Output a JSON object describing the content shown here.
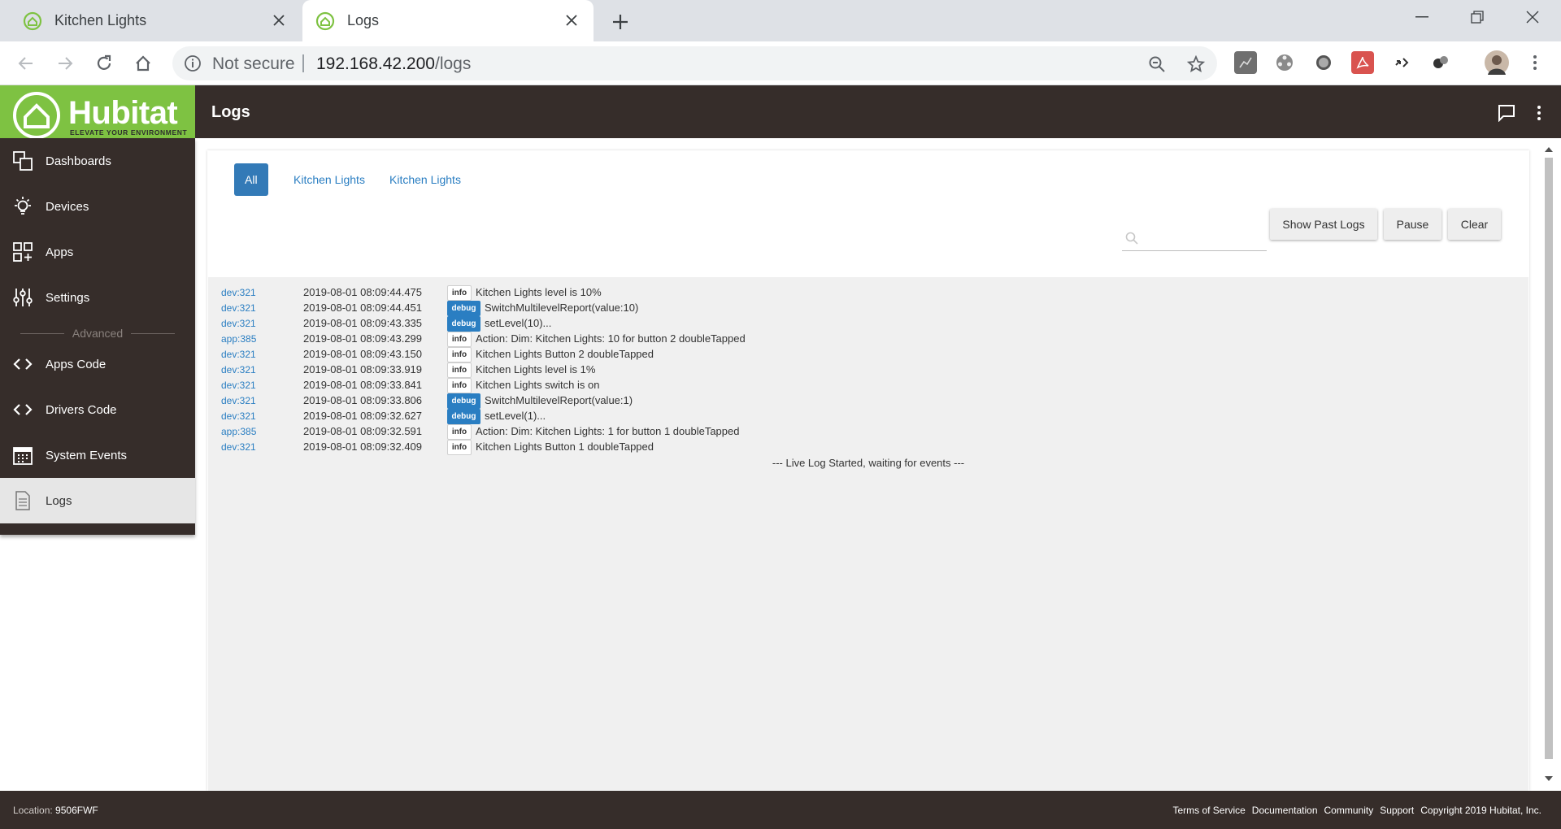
{
  "browser": {
    "tabs": [
      {
        "title": "Kitchen Lights",
        "active": false
      },
      {
        "title": "Logs",
        "active": true
      }
    ],
    "not_secure": "Not secure",
    "url_host": "192.168.42.200",
    "url_path": "/logs",
    "colors": {
      "tabstrip": "#dee1e6",
      "omnibox": "#f1f3f4"
    }
  },
  "app": {
    "logo_text": "Hubitat",
    "logo_tagline": "ELEVATE YOUR ENVIRONMENT",
    "page_title": "Logs",
    "colors": {
      "header": "#362d2a",
      "logo_green": "#7ec242",
      "link_blue": "#2a7ec2",
      "debug_blue": "#2a7ec2"
    }
  },
  "sidebar": {
    "items": [
      {
        "label": "Dashboards",
        "icon": "dashboards-icon"
      },
      {
        "label": "Devices",
        "icon": "lightbulb-icon"
      },
      {
        "label": "Apps",
        "icon": "apps-grid-icon"
      },
      {
        "label": "Settings",
        "icon": "sliders-icon"
      },
      {
        "label": "Apps Code",
        "icon": "code-icon"
      },
      {
        "label": "Drivers Code",
        "icon": "code-icon"
      },
      {
        "label": "System Events",
        "icon": "calendar-icon"
      },
      {
        "label": "Logs",
        "icon": "document-icon",
        "active": true
      }
    ],
    "advanced_label": "Advanced"
  },
  "filters": [
    "All",
    "Kitchen Lights",
    "Kitchen Lights"
  ],
  "search": {
    "placeholder": ""
  },
  "buttons": {
    "show_past": "Show Past Logs",
    "pause": "Pause",
    "clear": "Clear"
  },
  "logs": [
    {
      "src": "dev:321",
      "ts": "2019-08-01 08:09:44.475",
      "level": "info",
      "msg": "Kitchen Lights level is 10%"
    },
    {
      "src": "dev:321",
      "ts": "2019-08-01 08:09:44.451",
      "level": "debug",
      "msg": "SwitchMultilevelReport(value:10)"
    },
    {
      "src": "dev:321",
      "ts": "2019-08-01 08:09:43.335",
      "level": "debug",
      "msg": "setLevel(10)..."
    },
    {
      "src": "app:385",
      "ts": "2019-08-01 08:09:43.299",
      "level": "info",
      "msg": "Action: Dim: Kitchen Lights: 10 for button 2 doubleTapped"
    },
    {
      "src": "dev:321",
      "ts": "2019-08-01 08:09:43.150",
      "level": "info",
      "msg": "Kitchen Lights Button 2 doubleTapped"
    },
    {
      "src": "dev:321",
      "ts": "2019-08-01 08:09:33.919",
      "level": "info",
      "msg": "Kitchen Lights level is 1%"
    },
    {
      "src": "dev:321",
      "ts": "2019-08-01 08:09:33.841",
      "level": "info",
      "msg": "Kitchen Lights switch is on"
    },
    {
      "src": "dev:321",
      "ts": "2019-08-01 08:09:33.806",
      "level": "debug",
      "msg": "SwitchMultilevelReport(value:1)"
    },
    {
      "src": "dev:321",
      "ts": "2019-08-01 08:09:32.627",
      "level": "debug",
      "msg": "setLevel(1)..."
    },
    {
      "src": "app:385",
      "ts": "2019-08-01 08:09:32.591",
      "level": "info",
      "msg": "Action: Dim: Kitchen Lights: 1 for button 1 doubleTapped"
    },
    {
      "src": "dev:321",
      "ts": "2019-08-01 08:09:32.409",
      "level": "info",
      "msg": "Kitchen Lights Button 1 doubleTapped"
    }
  ],
  "live_message": "--- Live Log Started, waiting for events ---",
  "footer": {
    "location_label": "Location:",
    "location_value": "9506FWF",
    "links": [
      "Terms of Service",
      "Documentation",
      "Community",
      "Support",
      "Copyright 2019 Hubitat, Inc."
    ]
  }
}
